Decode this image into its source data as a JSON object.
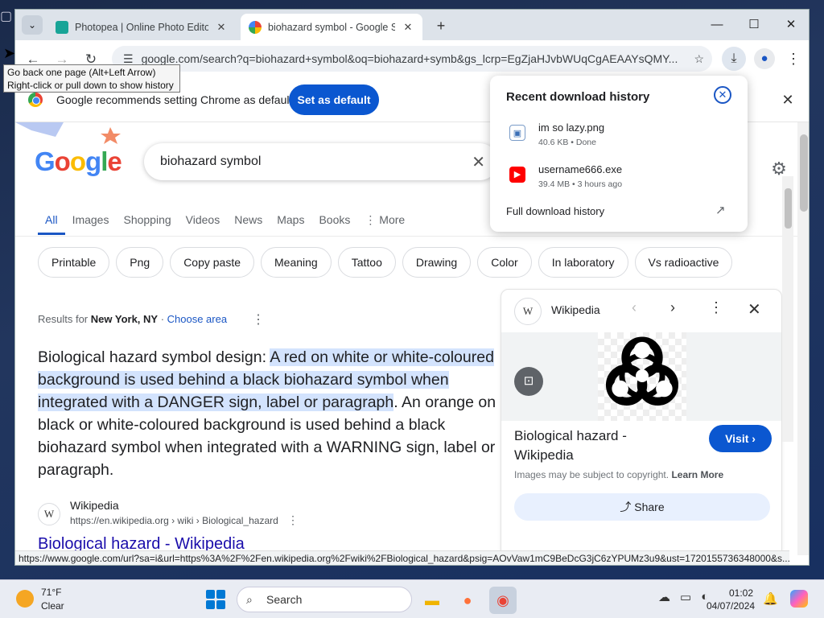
{
  "browser": {
    "tabs": [
      {
        "title": "Photopea | Online Photo Editor",
        "favicon": "photopea-icon"
      },
      {
        "title": "biohazard symbol - Google Search",
        "favicon": "google-g-icon"
      }
    ],
    "url": "google.com/search?q=biohazard+symbol&oq=biohazard+symb&gs_lcrp=EgZjaHJvbWUqCgAEAAYsQMY...",
    "tooltip_line1": "Go back one page (Alt+Left Arrow)",
    "tooltip_line2": "Right-click or pull down to show history",
    "infobar_text": "Google recommends setting Chrome as default",
    "set_default_label": "Set as default",
    "status_url": "https://www.google.com/url?sa=i&url=https%3A%2F%2Fen.wikipedia.org%2Fwiki%2FBiological_hazard&psig=AOvVaw1mC9BeDcG3jC6zYPUMz3u9&ust=1720155736348000&s..."
  },
  "downloads": {
    "title": "Recent download history",
    "items": [
      {
        "name": "im so lazy.png",
        "meta": "40.6 KB • Done"
      },
      {
        "name": "username666.exe",
        "meta": "39.4 MB • 3 hours ago"
      }
    ],
    "full_history": "Full download history"
  },
  "search": {
    "logo": "Google",
    "query": "biohazard symbol",
    "tabs": [
      "All",
      "Images",
      "Shopping",
      "Videos",
      "News",
      "Maps",
      "Books",
      "More"
    ],
    "chips": [
      "Printable",
      "Png",
      "Copy paste",
      "Meaning",
      "Tattoo",
      "Drawing",
      "Color",
      "In laboratory",
      "Vs radioactive"
    ],
    "results_for_prefix": "Results for ",
    "results_for_location": "New York, NY",
    "results_for_sep": " · ",
    "choose_area": "Choose area",
    "snippet_plain1": "Biological hazard symbol design: ",
    "snippet_highlight": "A red on white or white-coloured background is used behind a black biohazard symbol when integrated with a DANGER sign, label or paragraph",
    "snippet_plain2": ". An orange on black or white-coloured background is used behind a black biohazard symbol when integrated with a WARNING sign, label or paragraph.",
    "result_site": "Wikipedia",
    "result_url": "https://en.wikipedia.org › wiki › Biological_hazard",
    "result_title": "Biological hazard - Wikipedia"
  },
  "panel": {
    "source": "Wikipedia",
    "title": "Biological hazard - Wikipedia",
    "visit": "Visit",
    "copyright_text": "Images may be subject to copyright. ",
    "learn_more": "Learn More",
    "share": "Share"
  },
  "taskbar": {
    "temp": "71°F",
    "condition": "Clear",
    "search_placeholder": "Search",
    "time": "01:02",
    "date": "04/07/2024"
  },
  "colors": {
    "accent": "#0b57d0",
    "highlight": "#d3e3fd",
    "link": "#1a0dab"
  }
}
